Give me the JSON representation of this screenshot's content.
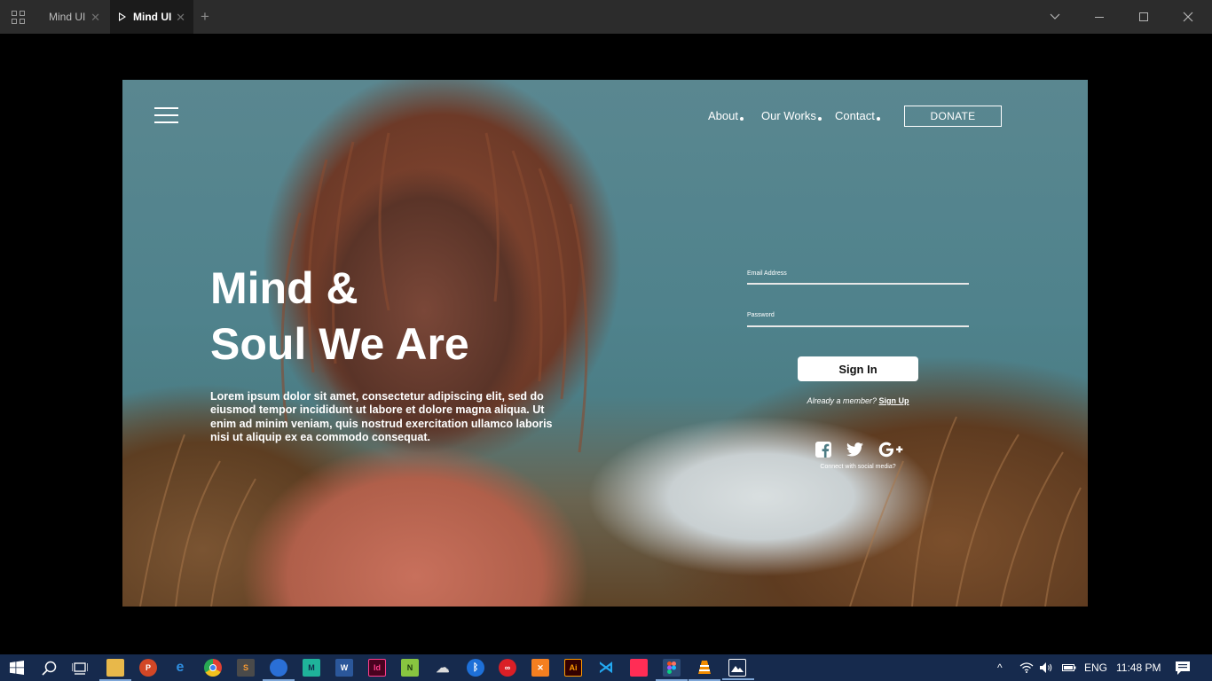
{
  "window": {
    "tabs": [
      {
        "label": "Mind UI"
      },
      {
        "label": "Mind UI"
      }
    ]
  },
  "nav": {
    "about": "About",
    "works": "Our Works",
    "contact": "Contact",
    "donate": "DONATE"
  },
  "hero": {
    "headline_line1": "Mind &",
    "headline_line2": "Soul We Are",
    "body": "Lorem ipsum dolor sit amet, consectetur adipiscing elit, sed do eiusmod tempor incididunt ut labore et dolore magna aliqua. Ut enim ad minim veniam, quis nostrud exercitation ullamco laboris nisi ut aliquip ex ea commodo consequat."
  },
  "form": {
    "email_label": "Email Address",
    "password_label": "Password",
    "signin": "Sign In",
    "member_text": "Already a member?",
    "signup": "Sign Up",
    "social_caption": "Connect with social media?",
    "social_icons": [
      "facebook-icon",
      "twitter-icon",
      "google-plus-icon"
    ]
  },
  "taskbar": {
    "language": "ENG",
    "time": "11:48 PM",
    "apps": [
      "file-explorer",
      "powerpoint",
      "edge",
      "chrome",
      "sublime",
      "firefox",
      "mantra",
      "word",
      "indesign",
      "notepad++",
      "paint",
      "bluetooth",
      "creative-cloud",
      "xampp",
      "illustrator",
      "vscode",
      "shape",
      "figma",
      "vlc",
      "photos"
    ]
  }
}
